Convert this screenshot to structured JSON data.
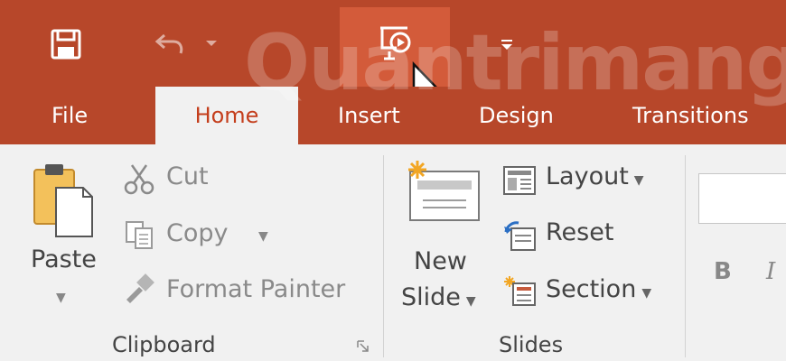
{
  "window": {
    "accent": "#b7472a",
    "accent_hover": "#d35b3a"
  },
  "quick_access": {
    "save_icon": "save-icon",
    "undo_icon": "undo-icon",
    "present_icon": "start-from-beginning-icon",
    "customize_icon": "customize-qat-icon"
  },
  "watermark": "Quantrimang",
  "tabs": [
    {
      "label": "File"
    },
    {
      "label": "Home"
    },
    {
      "label": "Insert"
    },
    {
      "label": "Design"
    },
    {
      "label": "Transitions"
    }
  ],
  "clipboard": {
    "paste_label": "Paste",
    "cut_label": "Cut",
    "copy_label": "Copy",
    "format_painter_label": "Format Painter",
    "group_label": "Clipboard"
  },
  "slides": {
    "new_slide_line1": "New",
    "new_slide_line2": "Slide",
    "layout_label": "Layout",
    "reset_label": "Reset",
    "section_label": "Section",
    "group_label": "Slides"
  },
  "font": {
    "bold_label": "B",
    "italic_label": "I"
  }
}
